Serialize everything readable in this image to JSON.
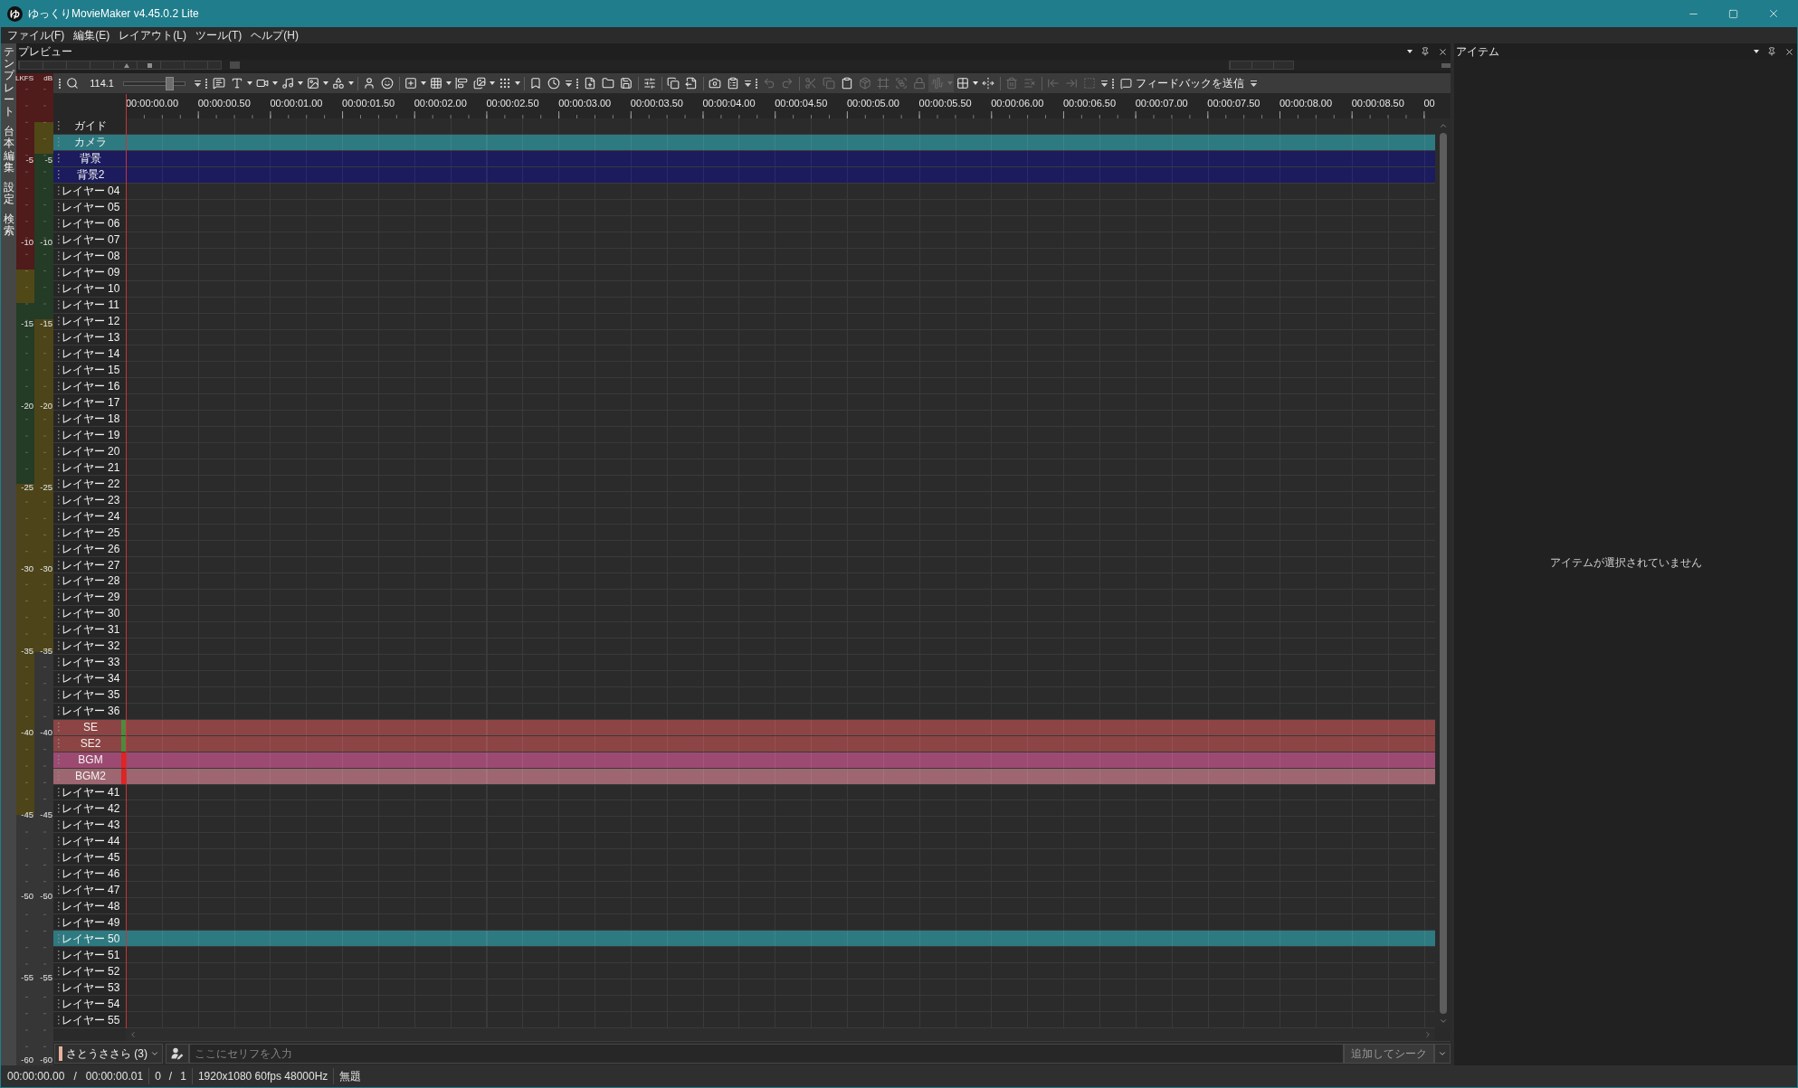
{
  "window": {
    "logo": "ゆ",
    "title": "ゆっくりMovieMaker v4.45.0.2 Lite"
  },
  "menu": [
    "ファイル(F)",
    "編集(E)",
    "レイアウト(L)",
    "ツール(T)",
    "ヘルプ(H)"
  ],
  "side_tabs": [
    "テンプレート",
    "台本編集",
    "設定",
    "検索"
  ],
  "preview_panel": {
    "title": "プレビュー"
  },
  "meters": [
    {
      "unit": "LKFS",
      "scale": [
        "-5",
        "-10",
        "-15",
        "-20",
        "-25",
        "-30",
        "-35",
        "-40",
        "-45",
        "-50",
        "-55",
        "-60"
      ]
    },
    {
      "unit": "dB",
      "scale": [
        "-5",
        "-10",
        "-15",
        "-20",
        "-25",
        "-30",
        "-35",
        "-40",
        "-45",
        "-50",
        "-55",
        "-60"
      ]
    }
  ],
  "toolbar": {
    "zoom_value": "114.1",
    "zoom_slider": {
      "level": 0.75
    },
    "edit_tools": [
      {
        "disabled": true
      },
      {
        "disabled": true
      },
      {
        "disabled": true
      },
      {
        "disabled": true
      },
      {
        "disabled": false
      },
      {
        "disabled": true
      },
      {
        "disabled": true
      },
      {
        "disabled": true
      },
      {
        "disabled": true
      },
      {
        "disabled": true
      },
      {
        "disabled": false
      },
      {
        "disabled": false
      },
      {
        "disabled": true
      },
      {
        "disabled": true
      },
      {
        "disabled": true
      },
      {
        "disabled": true
      },
      {
        "disabled": true
      }
    ],
    "feedback": "フィードバックを送信"
  },
  "timeline": {
    "ruler": [
      "00:00:00.00",
      "00:00:00.50",
      "00:00:01.00",
      "00:00:01.50",
      "00:00:02.00",
      "00:00:02.50",
      "00:00:03.00",
      "00:00:03.50",
      "00:00:04.00",
      "00:00:04.50",
      "00:00:05.00",
      "00:00:05.50",
      "00:00:06.00",
      "00:00:06.50",
      "00:00:07.00",
      "00:00:07.50",
      "00:00:08.00",
      "00:00:08.50",
      "00"
    ],
    "layers": [
      {
        "name": "ガイド"
      },
      {
        "name": "カメラ",
        "color": "#2e7a81"
      },
      {
        "name": "背景",
        "color": "#1b1b5e"
      },
      {
        "name": "背景2",
        "color": "#1b1b5e"
      },
      {
        "name": "レイヤー 04"
      },
      {
        "name": "レイヤー 05"
      },
      {
        "name": "レイヤー 06"
      },
      {
        "name": "レイヤー 07"
      },
      {
        "name": "レイヤー 08"
      },
      {
        "name": "レイヤー 09"
      },
      {
        "name": "レイヤー 10"
      },
      {
        "name": "レイヤー 11"
      },
      {
        "name": "レイヤー 12"
      },
      {
        "name": "レイヤー 13"
      },
      {
        "name": "レイヤー 14"
      },
      {
        "name": "レイヤー 15"
      },
      {
        "name": "レイヤー 16"
      },
      {
        "name": "レイヤー 17"
      },
      {
        "name": "レイヤー 18"
      },
      {
        "name": "レイヤー 19"
      },
      {
        "name": "レイヤー 20"
      },
      {
        "name": "レイヤー 21"
      },
      {
        "name": "レイヤー 22"
      },
      {
        "name": "レイヤー 23"
      },
      {
        "name": "レイヤー 24"
      },
      {
        "name": "レイヤー 25"
      },
      {
        "name": "レイヤー 26"
      },
      {
        "name": "レイヤー 27"
      },
      {
        "name": "レイヤー 28"
      },
      {
        "name": "レイヤー 29"
      },
      {
        "name": "レイヤー 30"
      },
      {
        "name": "レイヤー 31"
      },
      {
        "name": "レイヤー 32"
      },
      {
        "name": "レイヤー 33"
      },
      {
        "name": "レイヤー 34"
      },
      {
        "name": "レイヤー 35"
      },
      {
        "name": "レイヤー 36"
      },
      {
        "name": "SE",
        "color": "#8d4444",
        "indicator": {
          "color": "#4e8a3e"
        }
      },
      {
        "name": "SE2",
        "color": "#8d4444",
        "indicator": {
          "color": "#4e8a3e"
        }
      },
      {
        "name": "BGM",
        "color": "#9c4a72",
        "indicator": {
          "color": "#e02424"
        }
      },
      {
        "name": "BGM2",
        "color": "#9e6670",
        "indicator": {
          "color": "#e02424"
        }
      },
      {
        "name": "レイヤー 41"
      },
      {
        "name": "レイヤー 42"
      },
      {
        "name": "レイヤー 43"
      },
      {
        "name": "レイヤー 44"
      },
      {
        "name": "レイヤー 45"
      },
      {
        "name": "レイヤー 46"
      },
      {
        "name": "レイヤー 47"
      },
      {
        "name": "レイヤー 48"
      },
      {
        "name": "レイヤー 49"
      },
      {
        "name": "レイヤー 50",
        "color": "#2e7a81"
      },
      {
        "name": "レイヤー 51"
      },
      {
        "name": "レイヤー 52"
      },
      {
        "name": "レイヤー 53"
      },
      {
        "name": "レイヤー 54"
      },
      {
        "name": "レイヤー 55"
      }
    ]
  },
  "script_bar": {
    "character": {
      "name": "さとうささら (3)",
      "color": "#e6b29e"
    },
    "placeholder": "ここにセリフを入力",
    "submit": {
      "label": "追加してシーク",
      "disabled": true
    }
  },
  "status_bar": {
    "sections": [
      [
        "00:00:00.00",
        "/",
        "00:00:00.01"
      ],
      [
        "0",
        "/",
        "1"
      ],
      [
        "1920x1080 60fps 48000Hz"
      ],
      [
        "無題"
      ]
    ]
  },
  "item_panel": {
    "title": "アイテム",
    "message": "アイテムが選択されていません"
  }
}
